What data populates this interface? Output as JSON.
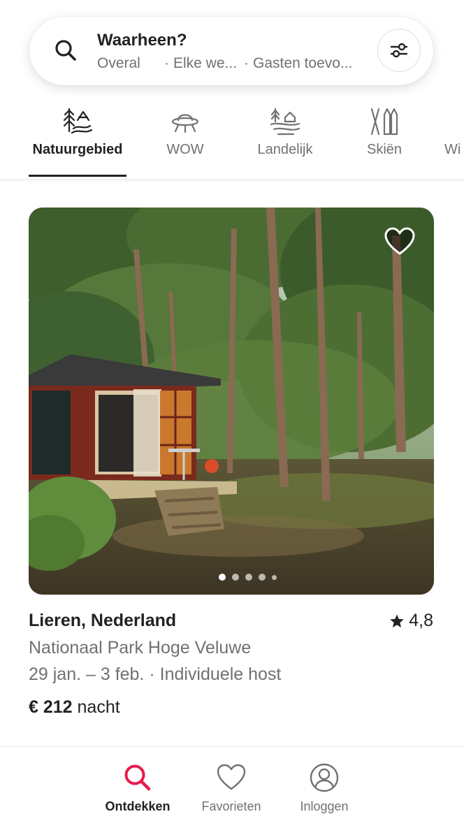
{
  "search": {
    "title": "Waarheen?",
    "where": "Overal",
    "when": "Elke we...",
    "guests": "Gasten toevo...",
    "separator": "·"
  },
  "categories": [
    {
      "label": "Natuurgebied",
      "icon": "nature-reserve-icon",
      "active": true
    },
    {
      "label": "WOW",
      "icon": "ufo-icon",
      "active": false
    },
    {
      "label": "Landelijk",
      "icon": "countryside-icon",
      "active": false
    },
    {
      "label": "Skiën",
      "icon": "skiing-icon",
      "active": false
    },
    {
      "label": "Wi",
      "icon": "",
      "active": false
    }
  ],
  "listing": {
    "title": "Lieren, Nederland",
    "rating": "4,8",
    "subtitle": "Nationaal Park Hoge Veluwe",
    "dates": "29 jan. – 3 feb. · Individuele host",
    "price": "€ 212",
    "price_unit": "nacht",
    "photo_count": 5,
    "photo_index": 1
  },
  "bottom_nav": [
    {
      "label": "Ontdekken",
      "icon": "search-icon",
      "active": true
    },
    {
      "label": "Favorieten",
      "icon": "heart-icon",
      "active": false
    },
    {
      "label": "Inloggen",
      "icon": "user-circle-icon",
      "active": false
    }
  ],
  "colors": {
    "accent": "#E61E4D",
    "text": "#222222",
    "secondary": "#717171"
  }
}
